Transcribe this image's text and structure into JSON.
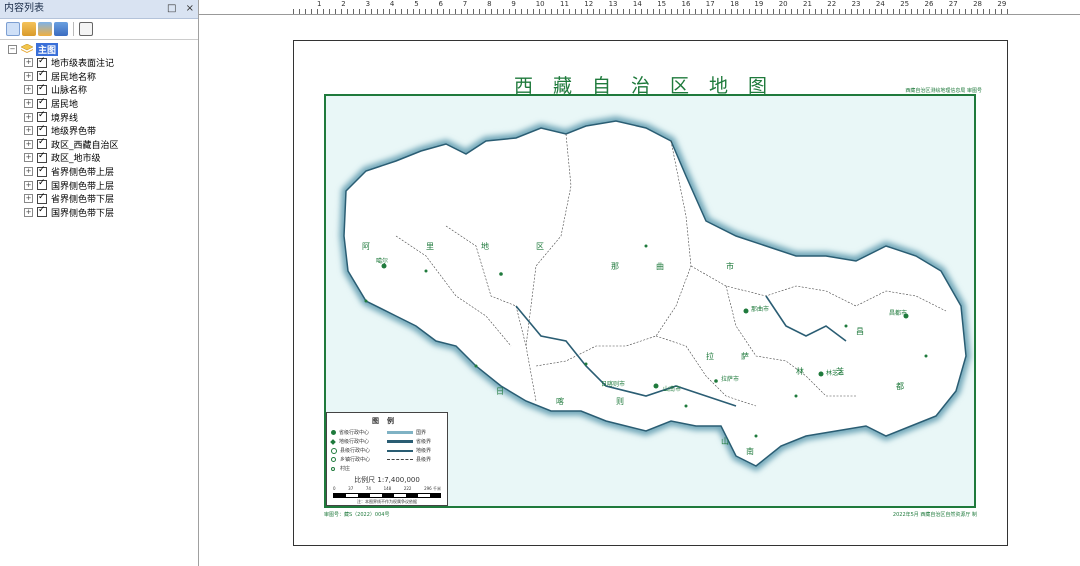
{
  "panel": {
    "title": "内容列表",
    "pin": "□",
    "close": "×",
    "root_label": "主图",
    "root_expander": "−",
    "layer_expander": "+",
    "layers": [
      {
        "label": "地市级表面注记"
      },
      {
        "label": "居民地名称"
      },
      {
        "label": "山脉名称"
      },
      {
        "label": "居民地"
      },
      {
        "label": "境界线"
      },
      {
        "label": "地级界色带"
      },
      {
        "label": "政区_西藏自治区"
      },
      {
        "label": "政区_地市级"
      },
      {
        "label": "省界侧色带上层"
      },
      {
        "label": "国界侧色带上层"
      },
      {
        "label": "省界侧色带下层"
      },
      {
        "label": "国界侧色带下层"
      }
    ]
  },
  "ruler": {
    "ticks": [
      "1",
      "2",
      "3",
      "4",
      "5",
      "6",
      "7",
      "8",
      "9",
      "10",
      "11",
      "12",
      "13",
      "14",
      "15",
      "16",
      "17",
      "18",
      "19",
      "20",
      "21",
      "22",
      "23",
      "24",
      "25",
      "26",
      "27",
      "28",
      "29"
    ]
  },
  "map": {
    "title": "西藏自治区地图",
    "header_note": "西藏自治区测绘地理信息局 审图号",
    "place_labels": [
      "阿",
      "里",
      "地",
      "区",
      "那",
      "曲",
      "市",
      "昌",
      "都",
      "日",
      "喀",
      "则",
      "山",
      "南",
      "拉",
      "萨",
      "林",
      "芝",
      "拉萨市",
      "日喀则市",
      "昌都市",
      "那曲市",
      "林芝市",
      "山南市",
      "噶尔"
    ],
    "legend": {
      "title": "图例",
      "items": [
        "省级行政中心",
        "地级行政中心",
        "县级行政中心",
        "乡镇行政中心",
        "村庄"
      ],
      "lines": [
        "国界",
        "省级界",
        "地级界",
        "县级界"
      ],
      "scale": "比例尺 1:7,400,000",
      "scale_ticks": [
        "0",
        "37",
        "74",
        "148",
        "222",
        "296 千米"
      ],
      "note": "注：本图界线不作为权属争议依据"
    },
    "footer_left": "审图号：藏S（2022）004号",
    "footer_right": "2022年5月    西藏自治区自然资源厅 制"
  },
  "colors": {
    "accent": "#1f7a3c",
    "sea": "#e9f7f7",
    "selected": "#3a6fd8"
  }
}
